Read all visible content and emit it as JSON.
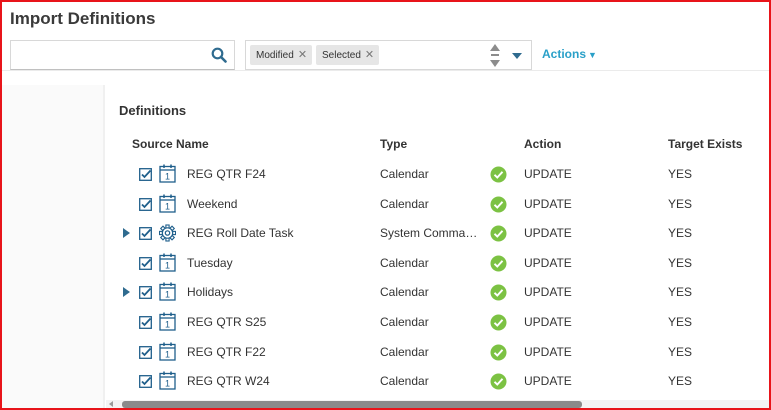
{
  "page": {
    "title": "Import Definitions"
  },
  "toolbar": {
    "search": {
      "value": "",
      "placeholder": ""
    },
    "filters": [
      {
        "label": "Modified"
      },
      {
        "label": "Selected"
      }
    ],
    "actions_label": "Actions"
  },
  "definitions": {
    "title": "Definitions",
    "columns": {
      "source_name": "Source Name",
      "type": "Type",
      "action": "Action",
      "target_exists": "Target Exists"
    },
    "rows": [
      {
        "name": "REG QTR F24",
        "type": "Calendar",
        "action": "UPDATE",
        "target_exists": "YES",
        "icon": "calendar-icon",
        "expandable": false,
        "checked": true
      },
      {
        "name": "Weekend",
        "type": "Calendar",
        "action": "UPDATE",
        "target_exists": "YES",
        "icon": "calendar-icon",
        "expandable": false,
        "checked": true
      },
      {
        "name": "REG Roll Date Task",
        "type": "System Comma…",
        "action": "UPDATE",
        "target_exists": "YES",
        "icon": "gear-icon",
        "expandable": true,
        "checked": true
      },
      {
        "name": "Tuesday",
        "type": "Calendar",
        "action": "UPDATE",
        "target_exists": "YES",
        "icon": "calendar-icon",
        "expandable": false,
        "checked": true
      },
      {
        "name": "Holidays",
        "type": "Calendar",
        "action": "UPDATE",
        "target_exists": "YES",
        "icon": "calendar-icon",
        "expandable": true,
        "checked": true
      },
      {
        "name": "REG QTR S25",
        "type": "Calendar",
        "action": "UPDATE",
        "target_exists": "YES",
        "icon": "calendar-icon",
        "expandable": false,
        "checked": true
      },
      {
        "name": "REG QTR F22",
        "type": "Calendar",
        "action": "UPDATE",
        "target_exists": "YES",
        "icon": "calendar-icon",
        "expandable": false,
        "checked": true
      },
      {
        "name": "REG QTR W24",
        "type": "Calendar",
        "action": "UPDATE",
        "target_exists": "YES",
        "icon": "calendar-icon",
        "expandable": false,
        "checked": true
      }
    ]
  },
  "colors": {
    "accent": "#2aa0c8",
    "status_ok": "#7cc243",
    "icon_blue": "#1f5f8b",
    "frame": "#e8141a"
  }
}
